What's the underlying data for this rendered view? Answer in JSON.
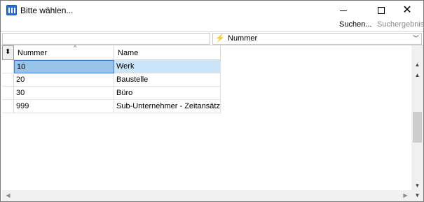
{
  "window": {
    "title": "Bitte wählen...",
    "icon": "app-grid-icon"
  },
  "toolbar": {
    "search_label": "Suchen...",
    "result_label": "Suchergebnis"
  },
  "filter": {
    "value": "",
    "column_selected": "Nummer",
    "column_icon": "lightning-icon"
  },
  "grid": {
    "columns": [
      "Nummer",
      "Name"
    ],
    "sort": {
      "column": "Nummer",
      "direction": "ascending"
    },
    "rows": [
      {
        "num": "10",
        "name": "Werk",
        "selected": true
      },
      {
        "num": "20",
        "name": "Baustelle",
        "selected": false
      },
      {
        "num": "30",
        "name": "Büro",
        "selected": false
      },
      {
        "num": "999",
        "name": "Sub-Unternehmer - Zeitansätze",
        "selected": false
      }
    ]
  },
  "colors": {
    "selected_cell": "#99c4ea",
    "selected_row": "#cce4f7",
    "accent": "#3a7bd5"
  }
}
